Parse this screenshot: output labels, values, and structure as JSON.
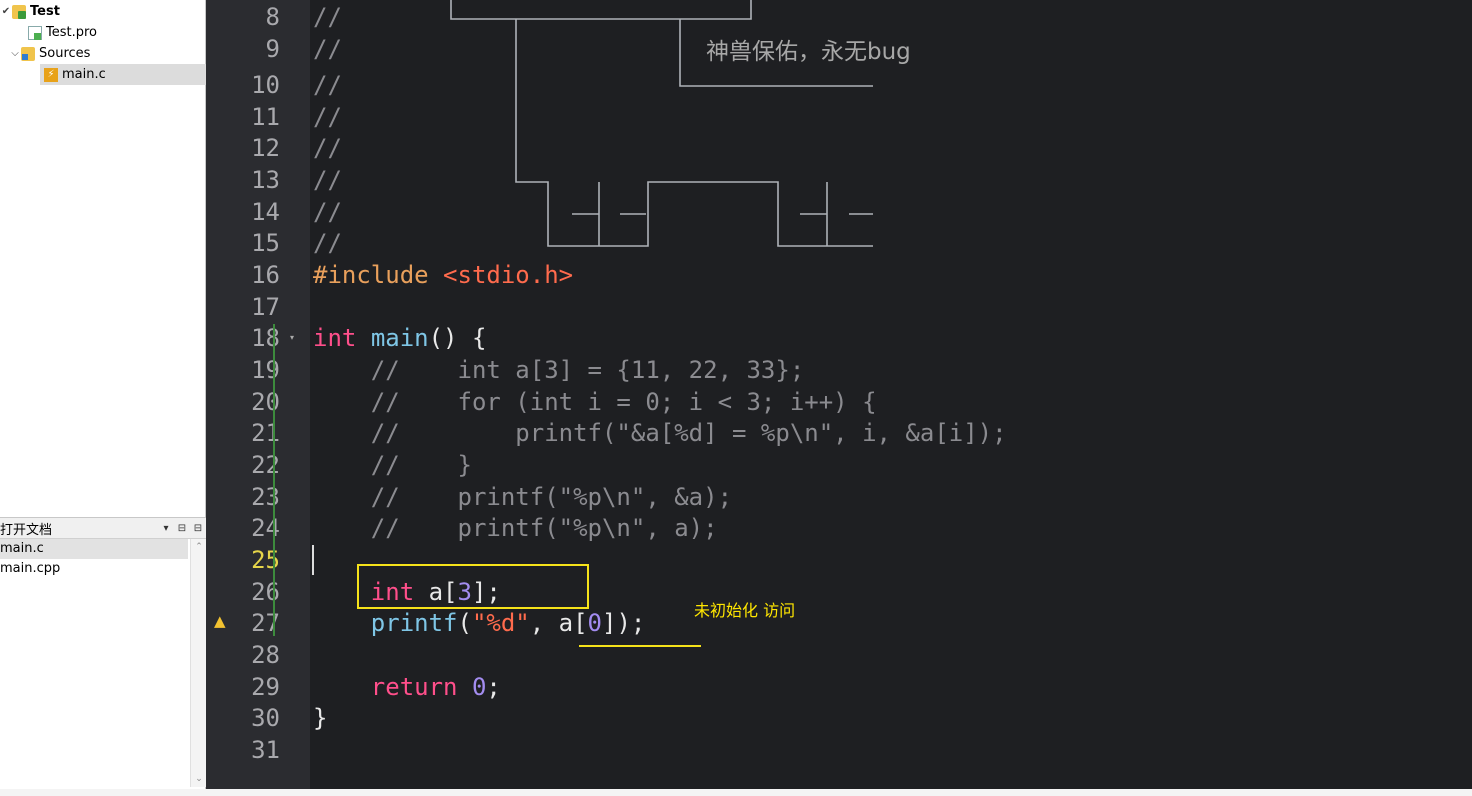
{
  "project_tree": {
    "project_name": "Test",
    "pro_file": "Test.pro",
    "sources_folder": "Sources",
    "source_file": "main.c"
  },
  "open_documents": {
    "title": "打开文档",
    "files": [
      "main.c",
      "main.cpp"
    ]
  },
  "editor": {
    "line_numbers": [
      "8",
      "9",
      "10",
      "11",
      "12",
      "13",
      "14",
      "15",
      "16",
      "17",
      "18",
      "19",
      "20",
      "21",
      "22",
      "23",
      "24",
      "25",
      "26",
      "27",
      "28",
      "29",
      "30",
      "31"
    ],
    "current_line": "25",
    "ascii_caption": "神兽保佑，永无bug",
    "lines": {
      "l8": "//",
      "l9": "//",
      "l10": "//",
      "l11": "//",
      "l12": "//",
      "l13": "//",
      "l14": "//",
      "l15": "//",
      "l16_directive": "#include",
      "l16_header": "<stdio.h>",
      "l18_kw": "int",
      "l18_fn": "main",
      "l18_rest": "() {",
      "l19": "    //    int a[3] = {11, 22, 33};",
      "l20": "    //    for (int i = 0; i < 3; i++) {",
      "l21": "    //        printf(\"&a[%d] = %p\\n\", i, &a[i]);",
      "l22": "    //    }",
      "l23": "    //    printf(\"%p\\n\", &a);",
      "l24": "    //    printf(\"%p\\n\", a);",
      "l26_kw": "int",
      "l26_rest": " a[",
      "l26_num": "3",
      "l26_end": "];",
      "l27_fn": "printf",
      "l27_open": "(",
      "l27_str": "\"%d\"",
      "l27_mid": ", a[",
      "l27_num": "0",
      "l27_end": "]);",
      "l29_kw": "return",
      "l29_num": "0",
      "l29_end": ";",
      "l30": "}"
    },
    "annotation": "未初始化 访问"
  },
  "colors": {
    "keyword": "#ff4f8b",
    "function": "#7fc6e6",
    "string": "#ff6b4d",
    "number": "#a38cf0",
    "comment": "#8b8b90",
    "annotation": "#ffe600"
  },
  "icons": [
    "expand-arrow-icon",
    "project-icon",
    "pro-file-icon",
    "sources-folder-icon",
    "c-file-icon",
    "warning-icon"
  ]
}
